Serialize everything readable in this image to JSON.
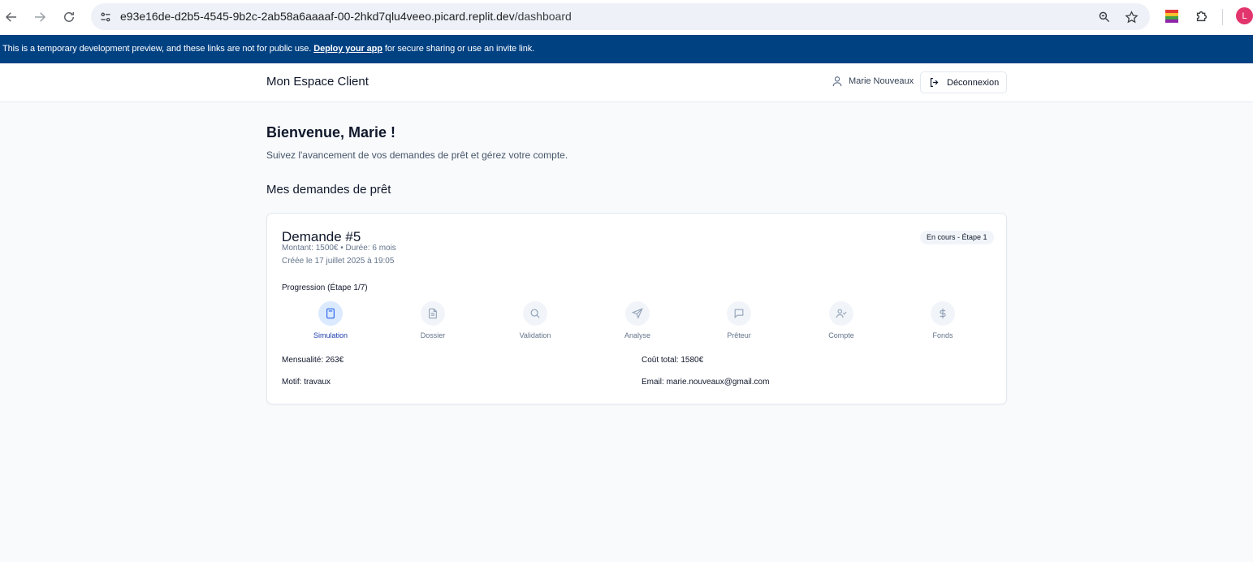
{
  "browser": {
    "url_host": "e93e16de-d2b5-4545-9b2c-2ab58a6aaaaf-00-2hkd7qlu4veeo.picard.replit.dev",
    "url_path": "/dashboard",
    "profile_initial": "L"
  },
  "banner": {
    "text_before": "This is a temporary development preview, and these links are not for public use. ",
    "link": "Deploy your app",
    "text_after": " for secure sharing or use an invite link."
  },
  "header": {
    "brand": "Mon Espace Client",
    "user_name": "Marie Nouveaux",
    "logout_label": "Déconnexion"
  },
  "welcome": {
    "title": "Bienvenue, Marie !",
    "subtitle": "Suivez l'avancement de vos demandes de prêt et gérez votre compte."
  },
  "section_title": "Mes demandes de prêt",
  "request": {
    "title": "Demande #5",
    "meta_line1": "Montant: 1500€ • Durée: 6 mois",
    "meta_line2": "Créée le 17 juillet 2025 à 19:05",
    "status": "En cours - Étape 1",
    "progress_label": "Progression (Étape 1/7)",
    "steps": [
      {
        "label": "Simulation",
        "icon": "calculator-icon",
        "active": true
      },
      {
        "label": "Dossier",
        "icon": "file-text-icon",
        "active": false
      },
      {
        "label": "Validation",
        "icon": "search-icon",
        "active": false
      },
      {
        "label": "Analyse",
        "icon": "send-icon",
        "active": false
      },
      {
        "label": "Prêteur",
        "icon": "message-square-icon",
        "active": false
      },
      {
        "label": "Compte",
        "icon": "user-check-icon",
        "active": false
      },
      {
        "label": "Fonds",
        "icon": "dollar-sign-icon",
        "active": false
      }
    ],
    "mensualite_label": "Mensualité:",
    "mensualite_value": " 263€",
    "cout_label": "Coût total:",
    "cout_value": " 1580€",
    "motif_label": "Motif:",
    "motif_value": " travaux",
    "email_label": "Email:",
    "email_value": " marie.nouveaux@gmail.com"
  },
  "colors": {
    "banner_bg": "#004182",
    "active_step_bg": "#dbeafe",
    "active_step_fg": "#2563eb"
  }
}
